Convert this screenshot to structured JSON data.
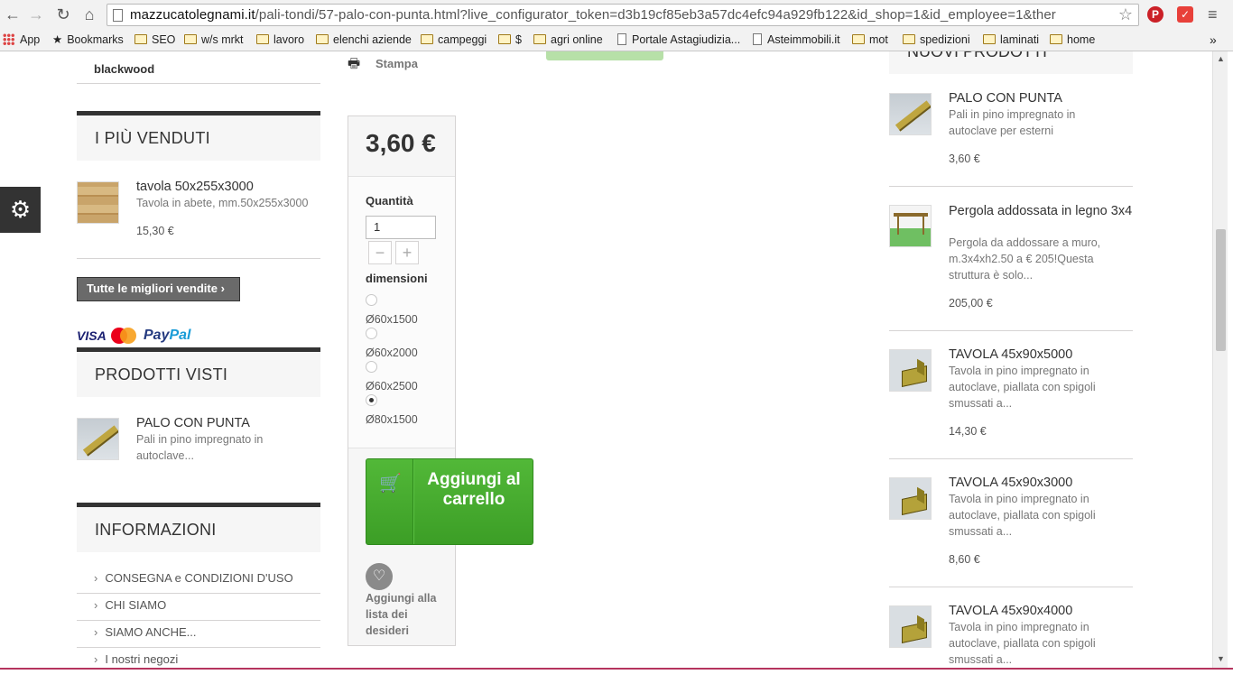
{
  "browser": {
    "url_host": "mazzucatolegnami.it",
    "url_path": "/pali-tondi/57-palo-con-punta.html?live_configurator_token=d3b19cf85eb3a57dc4efc94a929fb122&id_shop=1&id_employee=1&ther",
    "bookmarks": [
      "App",
      "Bookmarks",
      "SEO",
      "w/s mrkt",
      "lavoro",
      "elenchi aziende",
      "campeggi",
      "$",
      "agri online",
      "Portale Astagiudizia...",
      "Asteimmobili.it",
      "mot",
      "spedizioni",
      "laminati",
      "home"
    ],
    "more": "»"
  },
  "left": {
    "top_link": "blackwood",
    "best_sellers": {
      "title": "I PIÙ VENDUTI",
      "name": "tavola 50x255x3000",
      "desc": "Tavola in abete, mm.50x255x3000",
      "price": "15,30 €",
      "button": "Tutte le migliori vendite"
    },
    "payments": {
      "visa": "VISA",
      "mastercard": "MasterCard",
      "paypal_a": "Pay",
      "paypal_b": "Pal"
    },
    "viewed": {
      "title": "PRODOTTI VISTI",
      "name": "PALO CON PUNTA",
      "desc": "Pali in pino impregnato in autoclave..."
    },
    "info": {
      "title": "INFORMAZIONI",
      "items": [
        "CONSEGNA e CONDIZIONI D'USO",
        "CHI SIAMO",
        "SIAMO ANCHE...",
        "I nostri negozi"
      ]
    }
  },
  "center": {
    "print_label": "Stampa",
    "price": "3,60 €",
    "qty_label": "Quantità",
    "qty_value": "1",
    "minus": "−",
    "plus": "+",
    "dim_label": "dimensioni",
    "options": [
      "Ø60x1500",
      "Ø60x2000",
      "Ø60x2500",
      "Ø80x1500"
    ],
    "selected_option": "Ø80x1500",
    "add_to_cart": "Aggiungi al carrello",
    "wishlist": "Aggiungi alla lista dei desideri"
  },
  "right": {
    "title": "NUOVI PRODOTTI",
    "products": [
      {
        "name": "PALO CON PUNTA",
        "desc": "Pali in pino impregnato in autoclave per esterni",
        "price": "3,60 €"
      },
      {
        "name": "Pergola addossata in legno 3x4",
        "desc": "Pergola da addossare a muro, m.3x4xh2.50 a € 205!Questa struttura è solo...",
        "price": "205,00 €"
      },
      {
        "name": "TAVOLA 45x90x5000",
        "desc": "Tavola in pino impregnato in autoclave, piallata con spigoli smussati a...",
        "price": "14,30 €"
      },
      {
        "name": "TAVOLA 45x90x3000",
        "desc": "Tavola in pino impregnato in autoclave, piallata con spigoli smussati a...",
        "price": "8,60 €"
      },
      {
        "name": "TAVOLA 45x90x4000",
        "desc": "Tavola in pino impregnato in autoclave, piallata con spigoli smussati a...",
        "price": ""
      }
    ]
  },
  "colors": {
    "cart_green": "#46a82f",
    "title_bar": "#333333",
    "bg_block": "#f6f6f6"
  }
}
